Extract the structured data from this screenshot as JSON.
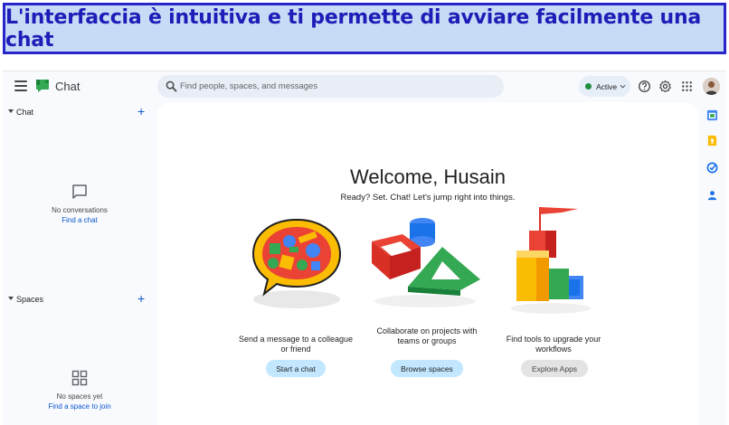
{
  "banner": {
    "text": "L'interfaccia è intuitiva e ti permette di avviare facilmente una chat"
  },
  "app": {
    "name": "Chat"
  },
  "search": {
    "placeholder": "Find people, spaces, and messages"
  },
  "status": {
    "label": "Active",
    "color": "#1e8e3e"
  },
  "topbar_icons": [
    "help-icon",
    "settings-icon",
    "apps-grid-icon",
    "avatar"
  ],
  "sidebar": {
    "chat_section": {
      "label": "Chat",
      "empty_text": "No conversations",
      "link": "Find a chat"
    },
    "spaces_section": {
      "label": "Spaces",
      "empty_text": "No spaces yet",
      "link": "Find a space to join"
    }
  },
  "main": {
    "title": "Welcome, Husain",
    "subtitle": "Ready? Set. Chat! Let's jump right into things.",
    "features": [
      {
        "text": "Send a message to a colleague or friend",
        "button": "Start a chat"
      },
      {
        "text": "Collaborate on projects with teams or groups",
        "button": "Browse spaces"
      },
      {
        "text": "Find tools to upgrade your workflows",
        "button": "Explore Apps"
      }
    ]
  },
  "rail_icons": [
    "calendar-icon",
    "keep-icon",
    "tasks-icon",
    "contacts-icon"
  ],
  "colors": {
    "accent": "#0b57d0",
    "banner_border": "#2626c9",
    "banner_bg": "#c6dbf5",
    "button_blue": "#c2e7ff",
    "button_grey": "#e3e3e3"
  }
}
